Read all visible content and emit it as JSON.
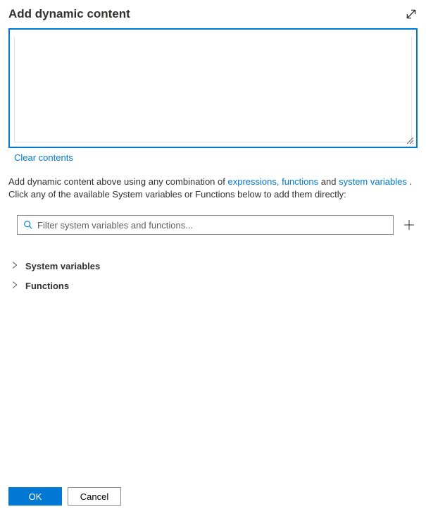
{
  "header": {
    "title": "Add dynamic content"
  },
  "actions": {
    "clear_label": "Clear contents"
  },
  "help": {
    "prefix": "Add dynamic content above using any combination of ",
    "link_expressions": "expressions,",
    "link_functions": "functions",
    "middle": " and ",
    "link_system_variables": "system variables",
    "suffix": " . Click any of the available System variables or Functions below to add them directly:"
  },
  "search": {
    "placeholder": "Filter system variables and functions..."
  },
  "tree": {
    "items": [
      {
        "label": "System variables"
      },
      {
        "label": "Functions"
      }
    ]
  },
  "footer": {
    "ok_label": "OK",
    "cancel_label": "Cancel"
  }
}
